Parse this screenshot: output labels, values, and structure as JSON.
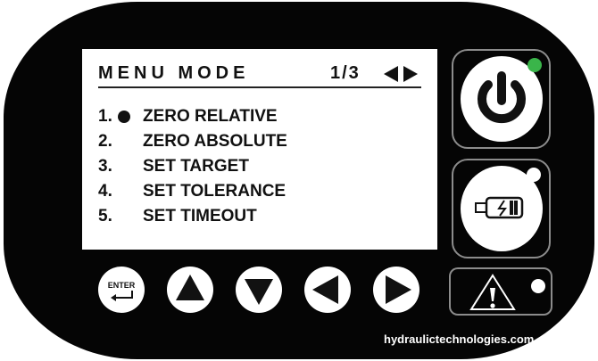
{
  "screen": {
    "title": "MENU MODE",
    "page_indicator": "1/3",
    "nav_arrows": "left-right-arrows-icon",
    "menu_items": [
      {
        "number": "1.",
        "label": "ZERO RELATIVE",
        "selected": true
      },
      {
        "number": "2.",
        "label": "ZERO ABSOLUTE",
        "selected": false
      },
      {
        "number": "3.",
        "label": "SET TARGET",
        "selected": false
      },
      {
        "number": "4.",
        "label": "SET TOLERANCE",
        "selected": false
      },
      {
        "number": "5.",
        "label": "SET TIMEOUT",
        "selected": false
      }
    ]
  },
  "buttons": {
    "enter_label": "ENTER",
    "power_icon": "power-icon",
    "battery_icon": "battery-charging-icon",
    "warning_icon": "warning-icon",
    "up_icon": "arrow-up-icon",
    "down_icon": "arrow-down-icon",
    "left_icon": "arrow-left-icon",
    "right_icon": "arrow-right-icon"
  },
  "leds": {
    "power": "#3ab54a",
    "battery": "#ffffff",
    "warning": "#ffffff"
  },
  "website": "hydraulictechnologies.com"
}
